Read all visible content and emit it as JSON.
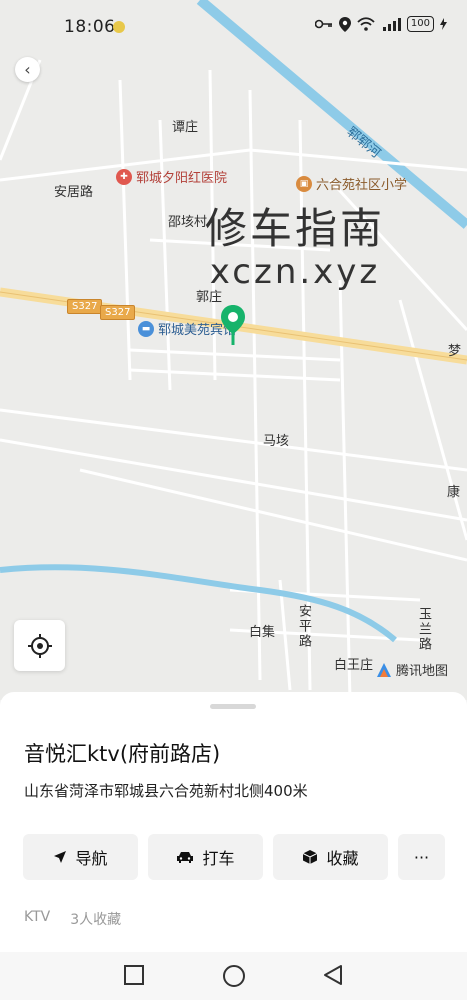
{
  "status": {
    "time": "18:06",
    "battery": "100"
  },
  "map": {
    "labels": {
      "tanzhuang": "谭庄",
      "anju_road": "安居路",
      "shaogai_village": "邵垓村",
      "guozhuang": "郭庄",
      "magai": "马垓",
      "kang": "康",
      "baiji": "白集",
      "baiwangzhuang": "白王庄",
      "anping_road": "安平路",
      "yulan_road": "玉兰路",
      "yunyun_river": "郓郓河",
      "edge_char": "梦"
    },
    "road_badges": [
      "S327",
      "S327"
    ],
    "pois": {
      "hospital": "郓城夕阳红医院",
      "school": "六合苑社区小学",
      "hotel": "郓城美苑宾馆"
    },
    "watermark": {
      "line1": "修车指南",
      "line2": "xczn.xyz"
    },
    "provider": "腾讯地图"
  },
  "place": {
    "title": "音悦汇ktv(府前路店)",
    "address": "山东省菏泽市郓城县六合苑新村北侧400米",
    "actions": {
      "navigate": "导航",
      "taxi": "打车",
      "favorite": "收藏",
      "more": "···"
    },
    "category": "KTV",
    "favorites": "3人收藏"
  }
}
